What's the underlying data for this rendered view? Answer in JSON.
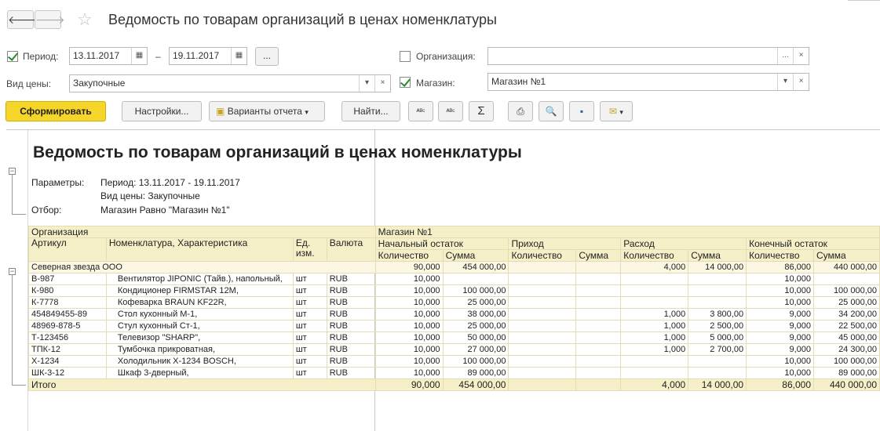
{
  "nav": {
    "back": "🡐",
    "forward": "🡒"
  },
  "window": {
    "title": "Ведомость по товарам организаций в ценах номенклатуры"
  },
  "filters": {
    "period_label": "Период:",
    "period_from": "13.11.2017",
    "period_dash": "–",
    "period_to": "19.11.2017",
    "dots": "...",
    "org_label": "Организация:",
    "org_value": "",
    "price_label": "Вид цены:",
    "price_value": "Закупочные",
    "shop_label": "Магазин:",
    "shop_value": "Магазин №1"
  },
  "toolbar": {
    "generate": "Сформировать",
    "settings": "Настройки...",
    "variants": "Варианты отчета",
    "find": "Найти...",
    "sum_symbol": "Σ"
  },
  "report": {
    "title": "Ведомость по товарам организаций в ценах номенклатуры",
    "params_label": "Параметры:",
    "period_line": "Период: 13.11.2017 - 19.11.2017",
    "price_line": "Вид цены: Закупочные",
    "filter_label": "Отбор:",
    "filter_line": "Магазин Равно \"Магазин №1\"",
    "headers": {
      "org": "Организация",
      "shop": "Магазин №1",
      "article": "Артикул",
      "nomen": "Номенклатура, Характеристика",
      "unit": "Ед. изм.",
      "currency": "Валюта",
      "start": "Начальный остаток",
      "income": "Приход",
      "expense": "Расход",
      "end": "Конечный остаток",
      "qty": "Количество",
      "sum": "Сумма"
    },
    "group": {
      "name": "Северная звезда ООО",
      "start_qty": "90,000",
      "start_sum": "454 000,00",
      "inc_qty": "",
      "inc_sum": "",
      "exp_qty": "4,000",
      "exp_sum": "14 000,00",
      "end_qty": "86,000",
      "end_sum": "440 000,00"
    },
    "rows": [
      {
        "art": "В-987",
        "name": "Вентилятор JIPONIC (Тайв.), напольный,",
        "unit": "шт",
        "cur": "RUB",
        "sq": "10,000",
        "ss": "",
        "iq": "",
        "is": "",
        "eq": "",
        "es": "",
        "fq": "10,000",
        "fs": ""
      },
      {
        "art": "К-980",
        "name": "Кондиционер FIRMSTAR 12M,",
        "unit": "шт",
        "cur": "RUB",
        "sq": "10,000",
        "ss": "100 000,00",
        "iq": "",
        "is": "",
        "eq": "",
        "es": "",
        "fq": "10,000",
        "fs": "100 000,00"
      },
      {
        "art": "К-7778",
        "name": "Кофеварка BRAUN KF22R,",
        "unit": "шт",
        "cur": "RUB",
        "sq": "10,000",
        "ss": "25 000,00",
        "iq": "",
        "is": "",
        "eq": "",
        "es": "",
        "fq": "10,000",
        "fs": "25 000,00"
      },
      {
        "art": "454849455-89",
        "name": "Стол кухонный М-1,",
        "unit": "шт",
        "cur": "RUB",
        "sq": "10,000",
        "ss": "38 000,00",
        "iq": "",
        "is": "",
        "eq": "1,000",
        "es": "3 800,00",
        "fq": "9,000",
        "fs": "34 200,00"
      },
      {
        "art": "48969-878-5",
        "name": "Стул кухонный Ст-1,",
        "unit": "шт",
        "cur": "RUB",
        "sq": "10,000",
        "ss": "25 000,00",
        "iq": "",
        "is": "",
        "eq": "1,000",
        "es": "2 500,00",
        "fq": "9,000",
        "fs": "22 500,00"
      },
      {
        "art": "Т-123456",
        "name": "Телевизор \"SHARP\",",
        "unit": "шт",
        "cur": "RUB",
        "sq": "10,000",
        "ss": "50 000,00",
        "iq": "",
        "is": "",
        "eq": "1,000",
        "es": "5 000,00",
        "fq": "9,000",
        "fs": "45 000,00"
      },
      {
        "art": "ТПК-12",
        "name": "Тумбочка прикроватная,",
        "unit": "шт",
        "cur": "RUB",
        "sq": "10,000",
        "ss": "27 000,00",
        "iq": "",
        "is": "",
        "eq": "1,000",
        "es": "2 700,00",
        "fq": "9,000",
        "fs": "24 300,00"
      },
      {
        "art": "Х-1234",
        "name": "Холодильник Х-1234 BOSCH,",
        "unit": "шт",
        "cur": "RUB",
        "sq": "10,000",
        "ss": "100 000,00",
        "iq": "",
        "is": "",
        "eq": "",
        "es": "",
        "fq": "10,000",
        "fs": "100 000,00"
      },
      {
        "art": "ШК-3-12",
        "name": "Шкаф 3-дверный,",
        "unit": "шт",
        "cur": "RUB",
        "sq": "10,000",
        "ss": "89 000,00",
        "iq": "",
        "is": "",
        "eq": "",
        "es": "",
        "fq": "10,000",
        "fs": "89 000,00"
      }
    ],
    "total": {
      "label": "Итого",
      "start_qty": "90,000",
      "start_sum": "454 000,00",
      "inc_qty": "",
      "inc_sum": "",
      "exp_qty": "4,000",
      "exp_sum": "14 000,00",
      "end_qty": "86,000",
      "end_sum": "440 000,00"
    }
  }
}
